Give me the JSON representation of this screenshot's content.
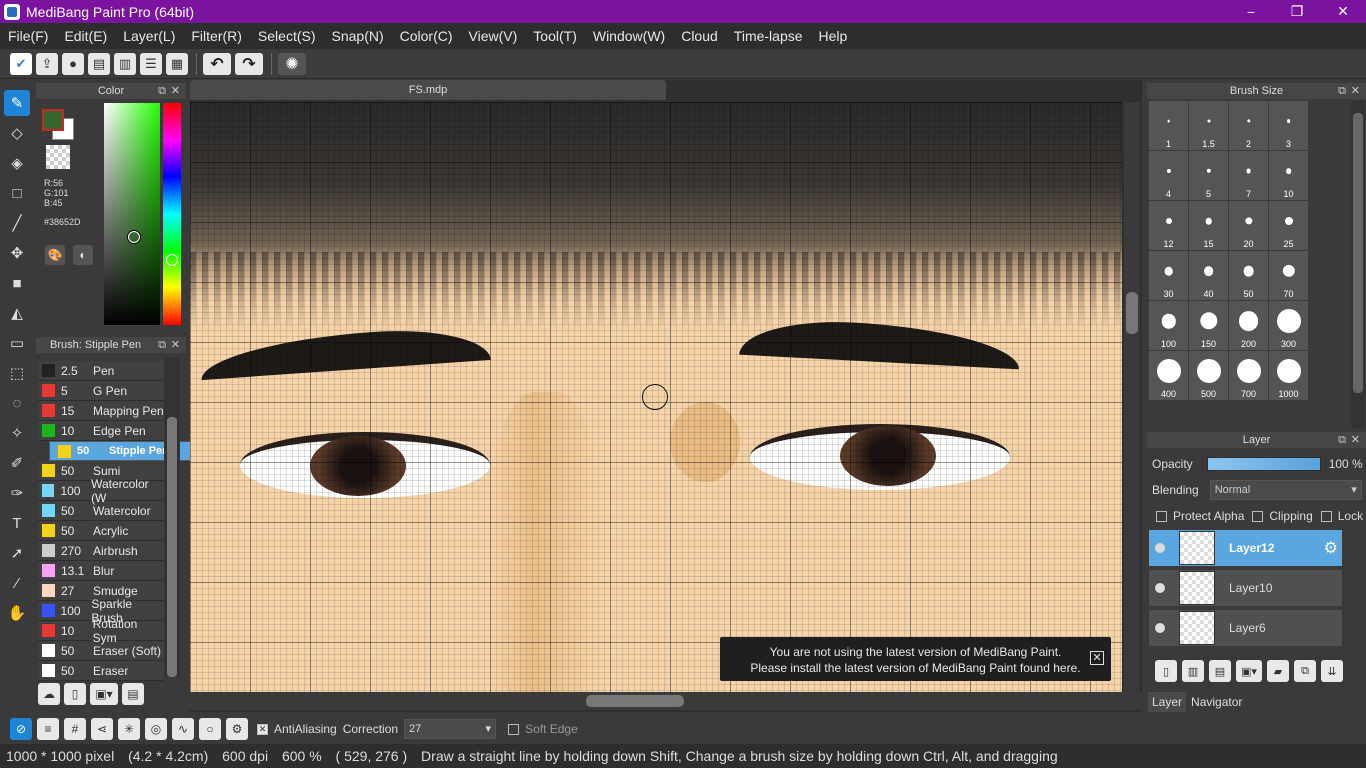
{
  "app": {
    "title": "MediBang Paint Pro (64bit)",
    "min": "−",
    "max": "❐",
    "close": "✕"
  },
  "menu": [
    "File(F)",
    "Edit(E)",
    "Layer(L)",
    "Filter(R)",
    "Select(S)",
    "Snap(N)",
    "Color(C)",
    "View(V)",
    "Tool(T)",
    "Window(W)",
    "Cloud",
    "Time-lapse",
    "Help"
  ],
  "color_panel": {
    "title": "Color",
    "r": "R:56",
    "g": "G:101",
    "b": "B:45",
    "hex": "#38652D",
    "fg": "#38652d",
    "bg": "#ffffff"
  },
  "brush_panel": {
    "title": "Brush: Stipple Pen",
    "brushes": [
      {
        "size": "2.5",
        "name": "Pen",
        "color": "#222222"
      },
      {
        "size": "5",
        "name": "G Pen",
        "color": "#e53935"
      },
      {
        "size": "15",
        "name": "Mapping Pen",
        "color": "#e53935"
      },
      {
        "size": "10",
        "name": "Edge Pen",
        "color": "#1db31d"
      },
      {
        "size": "50",
        "name": "Stipple Pen",
        "color": "#f2d21b"
      },
      {
        "size": "50",
        "name": "Sumi",
        "color": "#f2d21b"
      },
      {
        "size": "100",
        "name": "Watercolor (W",
        "color": "#73d7f5"
      },
      {
        "size": "50",
        "name": "Watercolor",
        "color": "#73d7f5"
      },
      {
        "size": "50",
        "name": "Acrylic",
        "color": "#f2d21b"
      },
      {
        "size": "270",
        "name": "Airbrush",
        "color": "#cccccc"
      },
      {
        "size": "13.1",
        "name": "Blur",
        "color": "#f7a4f5"
      },
      {
        "size": "27",
        "name": "Smudge",
        "color": "#f7d7c2"
      },
      {
        "size": "100",
        "name": "Sparkle Brush",
        "color": "#3b52f5"
      },
      {
        "size": "10",
        "name": "Rotation Sym",
        "color": "#e53935"
      },
      {
        "size": "50",
        "name": "Eraser (Soft)",
        "color": "#ffffff"
      },
      {
        "size": "50",
        "name": "Eraser",
        "color": "#ffffff"
      }
    ]
  },
  "document": {
    "tab": "FS.mdp"
  },
  "notice": {
    "line1": "You are not using the latest version of MediBang Paint.",
    "line2": "Please install the latest version of MediBang Paint found here.",
    "close": "✕"
  },
  "brush_size": {
    "title": "Brush Size",
    "sizes": [
      "1",
      "1.5",
      "2",
      "3",
      "4",
      "5",
      "7",
      "10",
      "12",
      "15",
      "20",
      "25",
      "30",
      "40",
      "50",
      "70",
      "100",
      "150",
      "200",
      "300",
      "400",
      "500",
      "700",
      "1000"
    ]
  },
  "layer_panel": {
    "title": "Layer",
    "opacity_label": "Opacity",
    "opacity_value": "100 %",
    "opacity": 1.0,
    "blending_label": "Blending",
    "blending_value": "Normal",
    "protect_alpha": "Protect Alpha",
    "clipping": "Clipping",
    "lock": "Lock",
    "layers": [
      {
        "name": "Layer12",
        "active": true
      },
      {
        "name": "Layer10",
        "active": false
      },
      {
        "name": "Layer6",
        "active": false
      }
    ],
    "tabs": [
      "Layer",
      "Navigator"
    ]
  },
  "brush_bar": {
    "antialiasing": "AntiAliasing",
    "correction_label": "Correction",
    "correction_value": "27",
    "soft_edge": "Soft Edge"
  },
  "status": {
    "size": "1000 * 1000 pixel",
    "cm": "(4.2 * 4.2cm)",
    "dpi": "600 dpi",
    "zoom": "600 %",
    "coords": "( 529, 276 )",
    "hint": "Draw a straight line by holding down Shift, Change a brush size by holding down Ctrl, Alt, and dragging"
  }
}
